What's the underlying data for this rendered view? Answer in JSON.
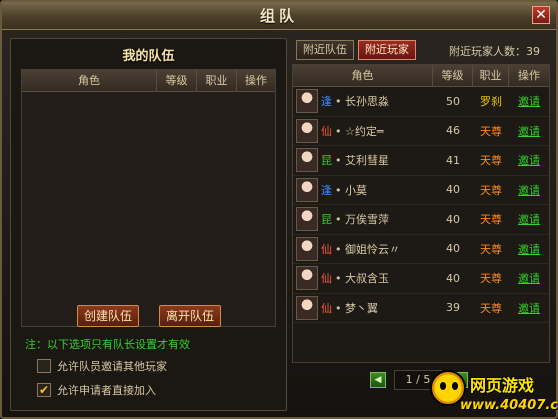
{
  "window": {
    "title": "组队",
    "close": "✕"
  },
  "left": {
    "title": "我的队伍",
    "columns": [
      "角色",
      "等级",
      "职业",
      "操作"
    ],
    "create_btn": "创建队伍",
    "leave_btn": "离开队伍",
    "note": "注：以下选项只有队长设置才有效",
    "opt1": "允许队员邀请其他玩家",
    "opt1_checked": "",
    "opt2": "允许申请者直接加入",
    "opt2_checked": "✔"
  },
  "right": {
    "tab_nearby_team": "附近队伍",
    "tab_nearby_player": "附近玩家",
    "player_count": "附近玩家人数：39",
    "columns": [
      "角色",
      "等级",
      "职业",
      "操作"
    ],
    "players": [
      {
        "faction": "逢",
        "name": "长孙思淼",
        "level": "50",
        "job": "罗刹",
        "job_color": "#e7c400",
        "faction_color": "#3a8bff",
        "action": "邀请"
      },
      {
        "faction": "仙",
        "name": "☆约定═",
        "level": "46",
        "job": "天尊",
        "job_color": "#ff8c1a",
        "faction_color": "#ff5a3a",
        "action": "邀请"
      },
      {
        "faction": "昆",
        "name": "艾利彗星",
        "level": "41",
        "job": "天尊",
        "job_color": "#ff8c1a",
        "faction_color": "#35d02a",
        "action": "邀请"
      },
      {
        "faction": "逢",
        "name": "小莫",
        "level": "40",
        "job": "天尊",
        "job_color": "#ff8c1a",
        "faction_color": "#3a8bff",
        "action": "邀请"
      },
      {
        "faction": "昆",
        "name": "万俟雪萍",
        "level": "40",
        "job": "天尊",
        "job_color": "#ff8c1a",
        "faction_color": "#35d02a",
        "action": "邀请"
      },
      {
        "faction": "仙",
        "name": "御姐怜云〃",
        "level": "40",
        "job": "天尊",
        "job_color": "#ff8c1a",
        "faction_color": "#ff5a3a",
        "action": "邀请"
      },
      {
        "faction": "仙",
        "name": "大叔含玉",
        "level": "40",
        "job": "天尊",
        "job_color": "#ff8c1a",
        "faction_color": "#ff5a3a",
        "action": "邀请"
      },
      {
        "faction": "仙",
        "name": "梦丶翼",
        "level": "39",
        "job": "天尊",
        "job_color": "#ff8c1a",
        "faction_color": "#ff5a3a",
        "action": "邀请"
      }
    ],
    "pager": {
      "prev": "◀",
      "page": "1 / 5",
      "next": "▶"
    }
  },
  "logo": {
    "text1": "网页游戏",
    "text2": "www.40407.com"
  }
}
